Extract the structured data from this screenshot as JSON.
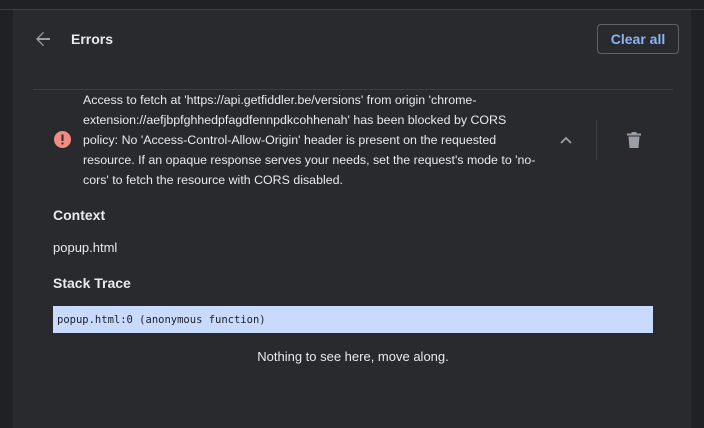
{
  "header": {
    "title": "Errors",
    "clear_all_label": "Clear all"
  },
  "error": {
    "message": "Access to fetch at 'https://api.getfiddler.be/versions' from origin 'chrome-extension://aefjbpfghhedpfagdfennpdkcohhenah' has been blocked by CORS policy: No 'Access-Control-Allow-Origin' header is present on the requested resource. If an opaque response serves your needs, set the request's mode to 'no-cors' to fetch the resource with CORS disabled."
  },
  "context": {
    "heading": "Context",
    "value": "popup.html"
  },
  "stack_trace": {
    "heading": "Stack Trace",
    "frames": [
      "popup.html:0 (anonymous function)"
    ],
    "empty_message": "Nothing to see here, move along."
  },
  "colors": {
    "accent": "#8ab4f8",
    "error_icon": "#f28b82",
    "stack_highlight": "#c8dbff",
    "panel_background": "#292a2d"
  },
  "icons": {
    "back": "arrow-back-icon",
    "error": "error-icon",
    "collapse": "chevron-up-icon",
    "delete": "trash-icon"
  }
}
